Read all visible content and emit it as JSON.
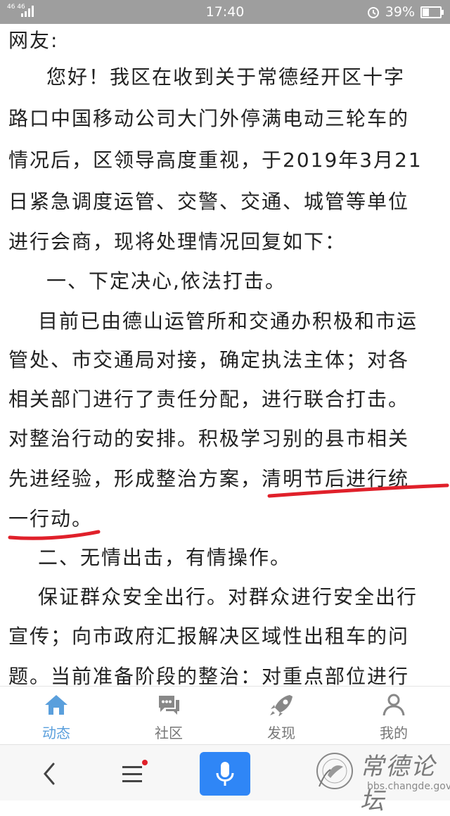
{
  "status_bar": {
    "signal": "46 46",
    "time": "17:40",
    "battery": "39%",
    "battery_level": 0.39
  },
  "article": {
    "lines": [
      "网友:",
      "您好！我区在收到关于常德经开区十字",
      "路口中国移动公司大门外停满电动三轮车的",
      "情况后，区领导高度重视，于2019年3月21",
      "日紧急调度运管、交警、交通、城管等单位",
      "进行会商，现将处理情况回复如下：",
      "一、下定决心,依法打击。",
      "目前已由德山运管所和交通办积极和市运",
      "管处、市交通局对接，确定执法主体；对各",
      "相关部门进行了责任分配，进行联合打击。",
      "对整治行动的安排。积极学习别的县市相关",
      "先进经验，形成整治方案，清明节后进行统",
      "一行动。",
      "二、无情出击，有情操作。",
      "保证群众安全出行。对群众进行安全出行",
      "宣传；向市政府汇报解决区域性出租车的问",
      "题。当前准备阶段的整治：对重点部位进行"
    ]
  },
  "tabs": [
    {
      "label": "动态",
      "icon": "home-icon",
      "active": true
    },
    {
      "label": "社区",
      "icon": "chat-icon",
      "active": false
    },
    {
      "label": "发现",
      "icon": "rocket-icon",
      "active": false
    },
    {
      "label": "我的",
      "icon": "person-icon",
      "active": false
    }
  ],
  "nav": {
    "back_icon": "back-icon",
    "menu_icon": "menu-icon",
    "mic_icon": "mic-icon"
  },
  "watermark": {
    "title": "常德论坛",
    "url": "bbs.changde.gov.cn"
  },
  "colors": {
    "accent": "#5a9fdc",
    "mic_button": "#2f86f6",
    "annotation": "#e0202a"
  }
}
